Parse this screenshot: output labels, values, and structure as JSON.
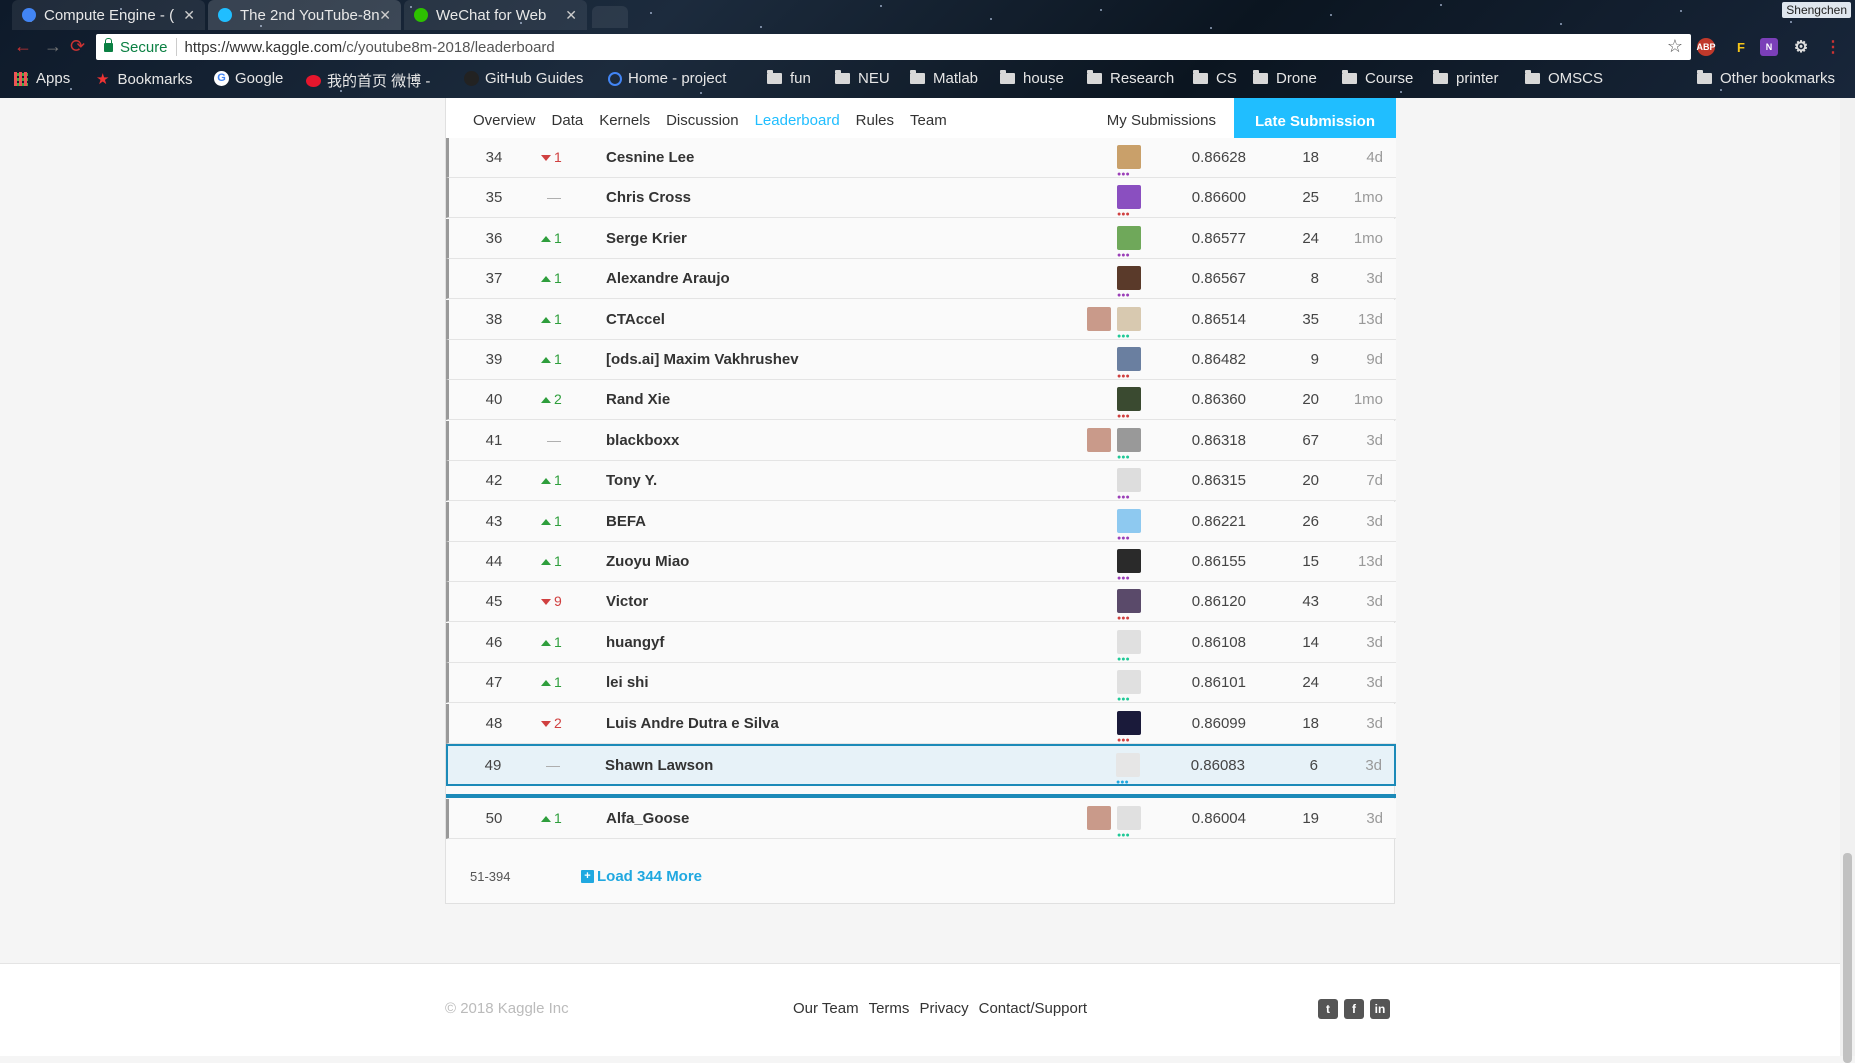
{
  "browser": {
    "tabs": [
      {
        "title": "Compute Engine - (",
        "icon_color": "#4285f4"
      },
      {
        "title": "The 2nd YouTube-8n",
        "icon_color": "#20beff"
      },
      {
        "title": "WeChat for Web",
        "icon_color": "#2dc100"
      }
    ],
    "profile": "Shengchen",
    "secure_label": "Secure",
    "url_host": "https://www.kaggle.com",
    "url_path": "/c/youtube8m-2018/leaderboard",
    "bookmarks": [
      {
        "label": "Apps",
        "icon": "apps-grid-icon"
      },
      {
        "label": "Bookmarks",
        "icon": "star-icon"
      },
      {
        "label": "Google",
        "icon": "google-icon"
      },
      {
        "label": "我的首页 微博 -",
        "icon": "weibo-icon"
      },
      {
        "label": "GitHub Guides",
        "icon": "github-icon"
      },
      {
        "label": "Home - project",
        "icon": "project-icon"
      },
      {
        "label": "fun",
        "icon": "folder-icon"
      },
      {
        "label": "NEU",
        "icon": "folder-icon"
      },
      {
        "label": "Matlab",
        "icon": "folder-icon"
      },
      {
        "label": "house",
        "icon": "folder-icon"
      },
      {
        "label": "Research",
        "icon": "folder-icon"
      },
      {
        "label": "CS",
        "icon": "folder-icon"
      },
      {
        "label": "Drone",
        "icon": "folder-icon"
      },
      {
        "label": "Course",
        "icon": "folder-icon"
      },
      {
        "label": "printer",
        "icon": "folder-icon"
      },
      {
        "label": "OMSCS",
        "icon": "folder-icon"
      },
      {
        "label": "Other bookmarks",
        "icon": "folder-icon"
      }
    ],
    "extensions": [
      "ABP",
      "F",
      "N"
    ]
  },
  "subnav": {
    "items": [
      "Overview",
      "Data",
      "Kernels",
      "Discussion",
      "Leaderboard",
      "Rules",
      "Team"
    ],
    "active": "Leaderboard",
    "my_submissions": "My Submissions",
    "late_submission": "Late Submission"
  },
  "leaderboard": {
    "rows": [
      {
        "rank": "34",
        "change": "1",
        "dir": "down",
        "team": "Cesnine Lee",
        "score": "0.86628",
        "entries": "18",
        "last": "4d"
      },
      {
        "rank": "35",
        "change": "—",
        "dir": "same",
        "team": "Chris Cross",
        "score": "0.86600",
        "entries": "25",
        "last": "1mo"
      },
      {
        "rank": "36",
        "change": "1",
        "dir": "up",
        "team": "Serge Krier",
        "score": "0.86577",
        "entries": "24",
        "last": "1mo"
      },
      {
        "rank": "37",
        "change": "1",
        "dir": "up",
        "team": "Alexandre Araujo",
        "score": "0.86567",
        "entries": "8",
        "last": "3d"
      },
      {
        "rank": "38",
        "change": "1",
        "dir": "up",
        "team": "CTAccel",
        "score": "0.86514",
        "entries": "35",
        "last": "13d"
      },
      {
        "rank": "39",
        "change": "1",
        "dir": "up",
        "team": "[ods.ai] Maxim Vakhrushev",
        "score": "0.86482",
        "entries": "9",
        "last": "9d"
      },
      {
        "rank": "40",
        "change": "2",
        "dir": "up",
        "team": "Rand Xie",
        "score": "0.86360",
        "entries": "20",
        "last": "1mo"
      },
      {
        "rank": "41",
        "change": "—",
        "dir": "same",
        "team": "blackboxx",
        "score": "0.86318",
        "entries": "67",
        "last": "3d"
      },
      {
        "rank": "42",
        "change": "1",
        "dir": "up",
        "team": "Tony Y.",
        "score": "0.86315",
        "entries": "20",
        "last": "7d"
      },
      {
        "rank": "43",
        "change": "1",
        "dir": "up",
        "team": "BEFA",
        "score": "0.86221",
        "entries": "26",
        "last": "3d"
      },
      {
        "rank": "44",
        "change": "1",
        "dir": "up",
        "team": "Zuoyu Miao",
        "score": "0.86155",
        "entries": "15",
        "last": "13d"
      },
      {
        "rank": "45",
        "change": "9",
        "dir": "down",
        "team": "Victor",
        "score": "0.86120",
        "entries": "43",
        "last": "3d"
      },
      {
        "rank": "46",
        "change": "1",
        "dir": "up",
        "team": "huangyf",
        "score": "0.86108",
        "entries": "14",
        "last": "3d"
      },
      {
        "rank": "47",
        "change": "1",
        "dir": "up",
        "team": "lei shi",
        "score": "0.86101",
        "entries": "24",
        "last": "3d"
      },
      {
        "rank": "48",
        "change": "2",
        "dir": "down",
        "team": "Luis Andre Dutra e Silva",
        "score": "0.86099",
        "entries": "18",
        "last": "3d"
      },
      {
        "rank": "49",
        "change": "—",
        "dir": "same",
        "team": "Shawn Lawson",
        "score": "0.86083",
        "entries": "6",
        "last": "3d",
        "highlight": true
      },
      {
        "rank": "50",
        "change": "1",
        "dir": "up",
        "team": "Alfa_Goose",
        "score": "0.86004",
        "entries": "19",
        "last": "3d"
      }
    ],
    "range_label": "51-394",
    "load_more_label": "Load 344 More"
  },
  "footer": {
    "copyright": "© 2018 Kaggle Inc",
    "links": [
      "Our Team",
      "Terms",
      "Privacy",
      "Contact/Support"
    ],
    "social": [
      "twitter-icon",
      "facebook-icon",
      "linkedin-icon"
    ]
  }
}
